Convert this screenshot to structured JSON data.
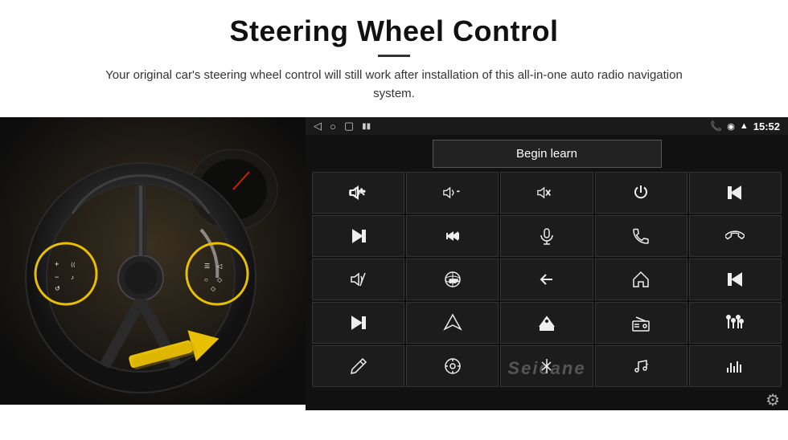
{
  "header": {
    "title": "Steering Wheel Control",
    "subtitle": "Your original car's steering wheel control will still work after installation of this all-in-one auto radio navigation system."
  },
  "screen": {
    "time": "15:52",
    "begin_learn_label": "Begin learn",
    "seicane_label": "Seicane",
    "icon_rows": [
      [
        "vol+",
        "vol-",
        "mute",
        "power",
        "prev-track"
      ],
      [
        "skip-next",
        "ff",
        "mic",
        "phone",
        "hang-up"
      ],
      [
        "speaker",
        "360cam",
        "back",
        "home",
        "skip-prev"
      ],
      [
        "skip-next2",
        "nav",
        "eject",
        "radio",
        "eq"
      ],
      [
        "pen",
        "settings-circle",
        "bluetooth",
        "music",
        "bars"
      ]
    ]
  }
}
